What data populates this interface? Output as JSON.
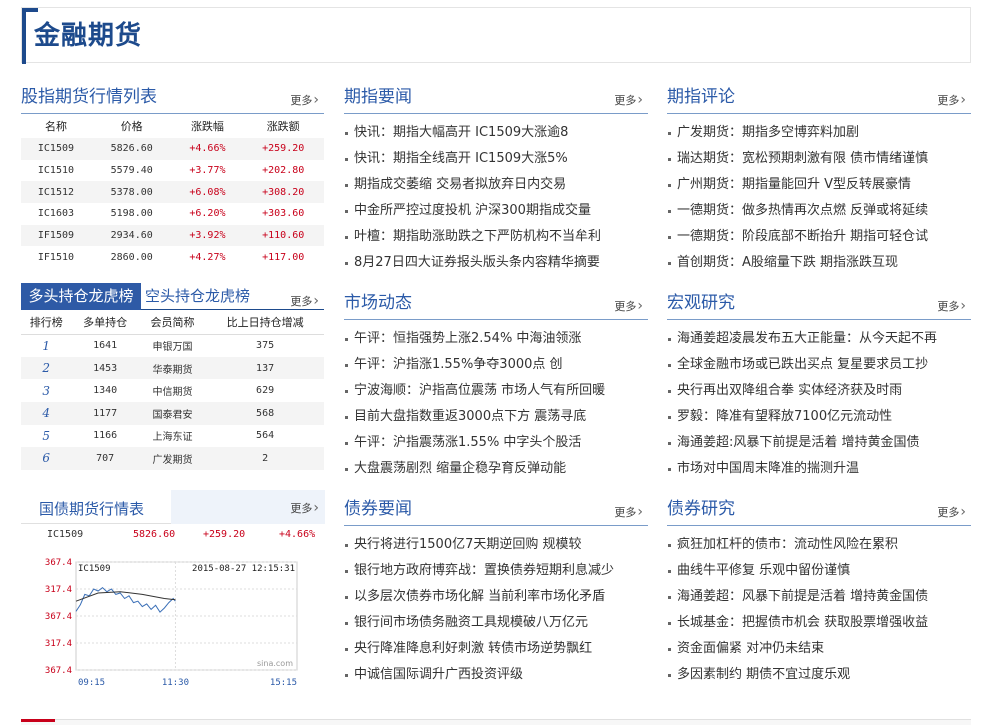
{
  "header": {
    "title": "金融期货"
  },
  "more_label": "更多",
  "left": {
    "quotes": {
      "title": "股指期货行情列表",
      "columns": [
        "名称",
        "价格",
        "涨跌幅",
        "涨跌额"
      ],
      "rows": [
        [
          "IC1509",
          "5826.60",
          "+4.66%",
          "+259.20"
        ],
        [
          "IC1510",
          "5579.40",
          "+3.77%",
          "+202.80"
        ],
        [
          "IC1512",
          "5378.00",
          "+6.08%",
          "+308.20"
        ],
        [
          "IC1603",
          "5198.00",
          "+6.20%",
          "+303.60"
        ],
        [
          "IF1509",
          "2934.60",
          "+3.92%",
          "+110.60"
        ],
        [
          "IF1510",
          "2860.00",
          "+4.27%",
          "+117.00"
        ]
      ]
    },
    "ranking": {
      "tab_active": "多头持仓龙虎榜",
      "tab_inactive": "空头持仓龙虎榜",
      "columns": [
        "排行榜",
        "多单持仓",
        "会员简称",
        "比上日持仓增减"
      ],
      "rows": [
        [
          "1",
          "1641",
          "申银万国",
          "375"
        ],
        [
          "2",
          "1453",
          "华泰期货",
          "137"
        ],
        [
          "3",
          "1340",
          "中信期货",
          "629"
        ],
        [
          "4",
          "1177",
          "国泰君安",
          "568"
        ],
        [
          "5",
          "1166",
          "上海东证",
          "564"
        ],
        [
          "6",
          "707",
          "广发期货",
          "2"
        ]
      ]
    },
    "bond_futures": {
      "title": "国债期货行情表",
      "row": {
        "code": "IC1509",
        "price": "5826.60",
        "change": "+259.20",
        "pct": "+4.66%"
      },
      "chart": {
        "symbol": "IC1509",
        "timestamp": "2015-08-27 12:15:31",
        "watermark": "sina.com",
        "y_ticks": [
          "367.4",
          "317.4",
          "367.4",
          "317.4",
          "367.4"
        ],
        "x_ticks": [
          "09:15",
          "11:30",
          "15:15"
        ],
        "colors": {
          "price": "#3a6fb7",
          "avg": "#333333",
          "tick": "#c8001a",
          "xtick": "#2b5aa8"
        }
      }
    }
  },
  "sections": [
    {
      "title": "期指要闻",
      "items": [
        "快讯：期指大幅高开 IC1509大涨逾8",
        "快讯：期指全线高开 IC1509大涨5%",
        "期指成交萎缩 交易者拟放弃日内交易",
        "中金所严控过度投机 沪深300期指成交量",
        "叶檀：期指助涨助跌之下严防机构不当牟利",
        "8月27日四大证券报头版头条内容精华摘要"
      ]
    },
    {
      "title": "期指评论",
      "items": [
        "广发期货：期指多空博弈料加剧",
        "瑞达期货：宽松预期刺激有限 债市情绪谨慎",
        "广州期货：期指量能回升 V型反转展豪情",
        "一德期货：做多热情再次点燃 反弹或将延续",
        "一德期货：阶段底部不断抬升 期指可轻仓试",
        "首创期货：A股缩量下跌 期指涨跌互现"
      ]
    },
    {
      "title": "市场动态",
      "items": [
        "午评：恒指强势上涨2.54% 中海油领涨",
        "午评：沪指涨1.55%争夺3000点 创",
        "宁波海顺：沪指高位震荡 市场人气有所回暖",
        "目前大盘指数重返3000点下方 震荡寻底",
        "午评：沪指震荡涨1.55% 中字头个股活",
        "大盘震荡剧烈 缩量企稳孕育反弹动能"
      ]
    },
    {
      "title": "宏观研究",
      "items": [
        "海通姜超凌晨发布五大正能量：从今天起不再",
        "全球金融市场或已跌出买点 复星要求员工抄",
        "央行再出双降组合拳 实体经济获及时雨",
        "罗毅：降准有望释放7100亿元流动性",
        "海通姜超:风暴下前提是活着 增持黄金国债",
        "市场对中国周末降准的揣测升温"
      ]
    },
    {
      "title": "债券要闻",
      "items": [
        "央行将进行1500亿7天期逆回购 规模较",
        "银行地方政府博弈战：置换债券短期利息减少",
        "以多层次债券市场化解 当前利率市场化矛盾",
        "银行间市场债务融资工具规模破八万亿元",
        "央行降准降息利好刺激 转债市场逆势飘红",
        "中诚信国际调升广西投资评级"
      ]
    },
    {
      "title": "债券研究",
      "items": [
        "疯狂加杠杆的债市：流动性风险在累积",
        "曲线牛平修复 乐观中留份谨慎",
        "海通姜超：风暴下前提是活着 增持黄金国债",
        "长城基金：把握债市机会 获取股票增强收益",
        "资金面偏紧 对冲仍未结束",
        "多因素制约 期债不宜过度乐观"
      ]
    }
  ]
}
